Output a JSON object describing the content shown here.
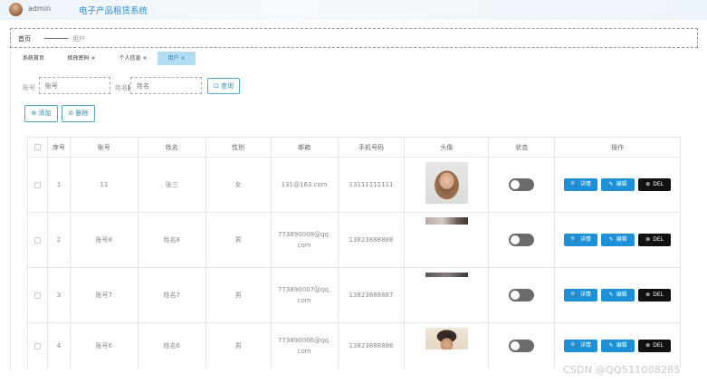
{
  "header": {
    "username": "admin",
    "system_title": "电子产品租赁系统"
  },
  "breadcrumb": {
    "home": "首页",
    "current": "用户"
  },
  "tabs": [
    {
      "label": "系统首页",
      "active": false
    },
    {
      "label": "修改密码 ×",
      "active": false
    },
    {
      "label": "个人信息 ×",
      "active": false
    },
    {
      "label": "用户 ×",
      "active": true
    }
  ],
  "search": {
    "account_label": "账号",
    "account_placeholder": "账号",
    "name_label": "姓名",
    "name_placeholder": "姓名",
    "query_label": "⊡ 查询"
  },
  "actions": {
    "add_label": "⊕ 添加",
    "delete_label": "⊘ 删除"
  },
  "table": {
    "columns": [
      "",
      "序号",
      "账号",
      "姓名",
      "性别",
      "邮箱",
      "手机号码",
      "头像",
      "状态",
      "操作"
    ],
    "rows": [
      {
        "index": "1",
        "account": "11",
        "name": "张三",
        "sex": "女",
        "email": "131@163.com",
        "phone": "13111111111",
        "avatar": "woman-photo"
      },
      {
        "index": "2",
        "account": "账号8",
        "name": "姓名8",
        "sex": "男",
        "email": "773890008@qq.com",
        "phone": "13823888888",
        "avatar": "cropped-photo"
      },
      {
        "index": "3",
        "account": "账号7",
        "name": "姓名7",
        "sex": "男",
        "email": "773890007@qq.com",
        "phone": "13823888887",
        "avatar": "cropped-photo"
      },
      {
        "index": "4",
        "account": "账号6",
        "name": "姓名6",
        "sex": "男",
        "email": "773890006@qq.com",
        "phone": "13823888886",
        "avatar": "man-photo"
      }
    ],
    "ops": {
      "detail": "详情",
      "edit": "编辑",
      "del": "DEL"
    }
  },
  "watermark": "CSDN @QQ511008285",
  "colors": {
    "primary": "#1e90d8",
    "title": "#2f8fd8",
    "active_tab": "#b4dcf3",
    "del_button": "#111111",
    "switch_off": "#6b6b6b"
  }
}
